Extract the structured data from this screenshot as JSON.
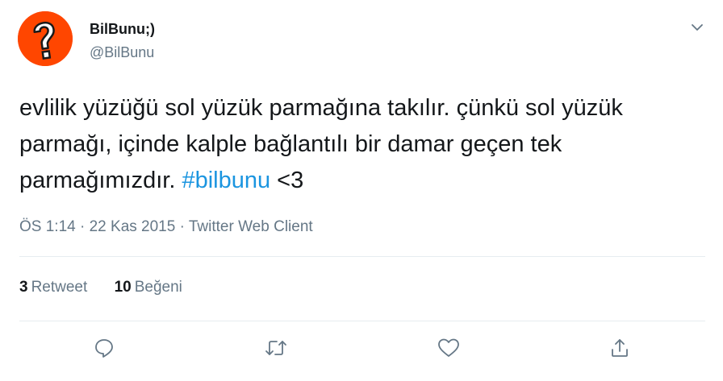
{
  "author": {
    "display_name": "BilBunu;)",
    "handle": "@BilBunu",
    "avatar_icon": "question-mark-logo"
  },
  "tweet": {
    "text_before": "evlilik yüzüğü sol yüzük parmağına takılır. çünkü sol yüzük parmağı, içinde kalple bağlantılı bir damar geçen tek parmağımızdır. ",
    "hashtag": "#bilbunu",
    "text_after": " <3"
  },
  "meta": {
    "time": "ÖS 1:14",
    "sep1": " · ",
    "date": "22 Kas 2015",
    "sep2": " · ",
    "client": "Twitter Web Client"
  },
  "stats": {
    "retweets_count": "3",
    "retweets_label": "Retweet",
    "likes_count": "10",
    "likes_label": "Beğeni"
  },
  "actions": [
    "reply-icon",
    "retweet-icon",
    "like-icon",
    "share-icon"
  ],
  "colors": {
    "brand": "#ff4600",
    "link": "#1b95e0",
    "secondary_text": "#657786",
    "divider": "#e6ecf0"
  }
}
